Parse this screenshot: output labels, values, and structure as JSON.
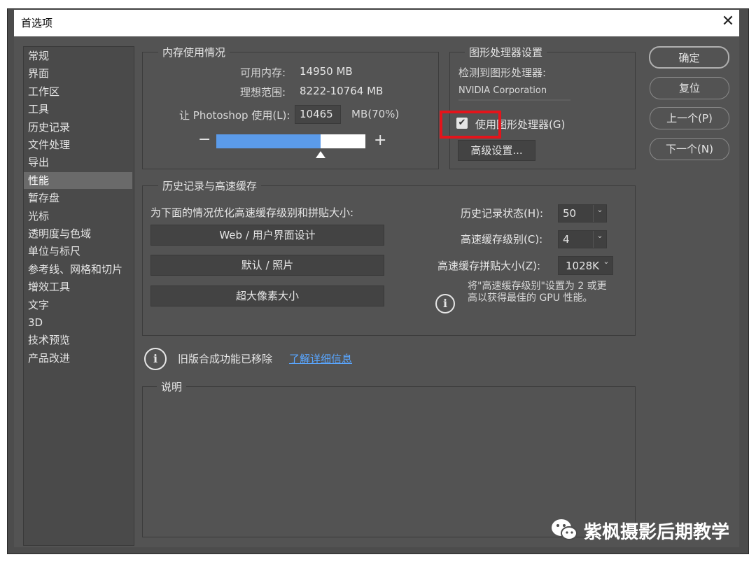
{
  "window": {
    "title": "首选项",
    "close_glyph": "✕"
  },
  "sidebar": {
    "items": [
      {
        "label": "常规"
      },
      {
        "label": "界面"
      },
      {
        "label": "工作区"
      },
      {
        "label": "工具"
      },
      {
        "label": "历史记录"
      },
      {
        "label": "文件处理"
      },
      {
        "label": "导出"
      },
      {
        "label": "性能",
        "selected": true
      },
      {
        "label": "暂存盘"
      },
      {
        "label": "光标"
      },
      {
        "label": "透明度与色域"
      },
      {
        "label": "单位与标尺"
      },
      {
        "label": "参考线、网格和切片"
      },
      {
        "label": "增效工具"
      },
      {
        "label": "文字"
      },
      {
        "label": "3D"
      },
      {
        "label": "技术预览"
      },
      {
        "label": "产品改进"
      }
    ]
  },
  "memory": {
    "legend": "内存使用情况",
    "available_label": "可用内存:",
    "available_value": "14950 MB",
    "ideal_label": "理想范围:",
    "ideal_value": "8222-10764 MB",
    "let_label": "让 Photoshop 使用(L):",
    "let_value": "10465",
    "unit_percent": "MB(70%)",
    "slider_percent": 70,
    "minus": "−",
    "plus": "+"
  },
  "gpu": {
    "legend": "图形处理器设置",
    "detected_label": "检测到图形处理器:",
    "detected_value": "NVIDIA Corporation",
    "use_gpu_label": "使用图形处理器(G)",
    "use_gpu_checked": true,
    "advanced_button": "高级设置..."
  },
  "history_cache": {
    "legend": "历史记录与高速缓存",
    "optimize_label": "为下面的情况优化高速缓存级别和拼贴大小:",
    "preset_buttons": [
      "Web / 用户界面设计",
      "默认 / 照片",
      "超大像素大小"
    ],
    "history_states_label": "历史记录状态(H):",
    "history_states_value": "50",
    "cache_levels_label": "高速缓存级别(C):",
    "cache_levels_value": "4",
    "tile_size_label": "高速缓存拼贴大小(Z):",
    "tile_size_value": "1028K",
    "tip_line1": "将\"高速缓存级别\"设置为 2 或更",
    "tip_line2": "高以获得最佳的 GPU 性能。"
  },
  "legacy": {
    "text": "旧版合成功能已移除",
    "link": "了解详细信息"
  },
  "description": {
    "legend": "说明"
  },
  "actions": {
    "ok": "确定",
    "reset": "复位",
    "prev": "上一个(P)",
    "next": "下一个(N)"
  },
  "watermark": {
    "text": "紫枫摄影后期教学"
  },
  "colors": {
    "accent_blue": "#5b9bea",
    "highlight_red": "#e4141b",
    "link_blue": "#59a6ff"
  }
}
